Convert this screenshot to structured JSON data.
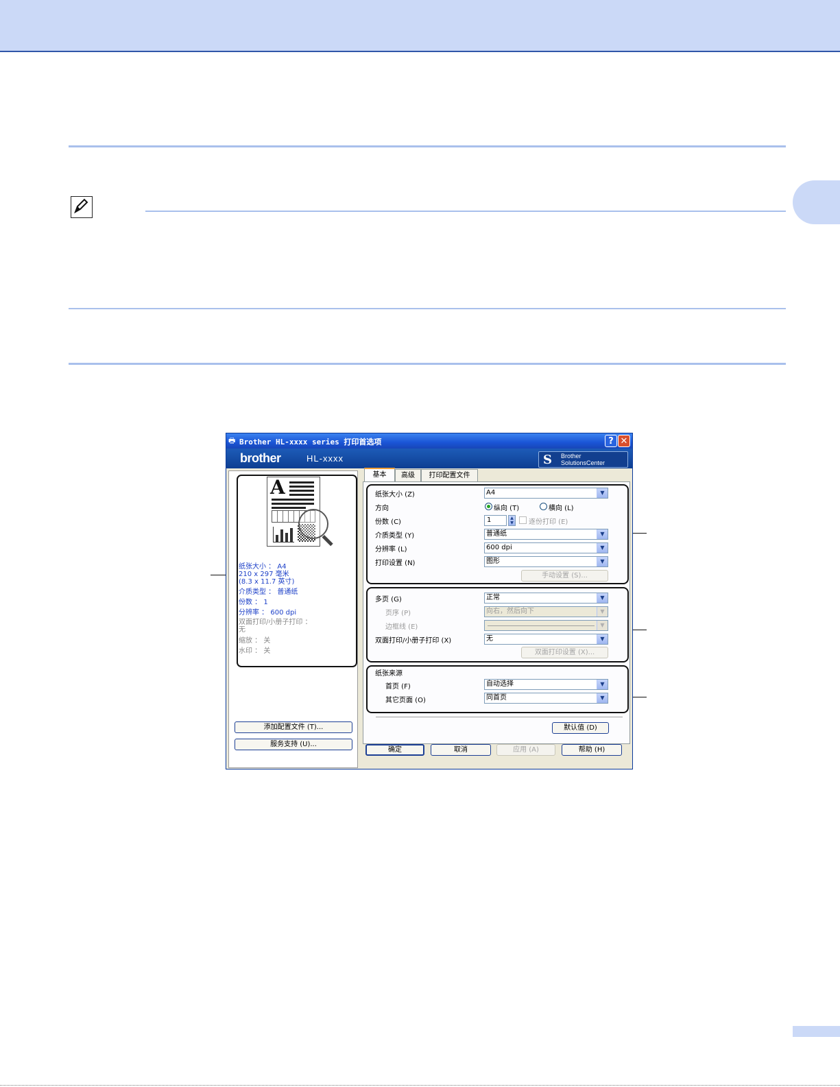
{
  "dialog": {
    "title": "Brother HL-xxxx series 打印首选项",
    "help_glyph": "?",
    "close_glyph": "✕",
    "brand": {
      "logo": "brother",
      "model": "HL-xxxx",
      "solutions_line1": "Brother",
      "solutions_line2": "SolutionsCenter"
    },
    "tabs": [
      "基本",
      "高级",
      "打印配置文件"
    ],
    "summary": {
      "paper_size": "纸张大小 ： A4",
      "dims_mm": "210 x 297 毫米",
      "dims_in": "(8.3 x 11.7 英寸)",
      "media": "介质类型 ： 普通纸",
      "copies": "份数 ： 1",
      "resolution": "分辨率 ： 600 dpi",
      "duplex": "双面打印/小册子打印 ：",
      "duplex_val": "无",
      "scaling": "缩放 ： 关",
      "watermark": "水印 ： 关"
    },
    "left_buttons": {
      "add_profile": "添加配置文件 (T)...",
      "support": "服务支持 (U)..."
    },
    "basic": {
      "paper_size": {
        "label": "纸张大小 (Z)",
        "value": "A4"
      },
      "orientation": {
        "label": "方向",
        "portrait": "纵向 (T)",
        "landscape": "横向 (L)"
      },
      "copies": {
        "label": "份数 (C)",
        "value": "1",
        "collate": "逐份打印 (E)"
      },
      "media_type": {
        "label": "介质类型 (Y)",
        "value": "普通纸"
      },
      "resolution": {
        "label": "分辨率 (L)",
        "value": "600 dpi"
      },
      "print_setting": {
        "label": "打印设置 (N)",
        "value": "图形"
      },
      "manual_settings": "手动设置 (S)...",
      "multiple_page": {
        "label": "多页 (G)",
        "value": "正常"
      },
      "page_order": {
        "label": "页序 (P)",
        "value": "向右，然后向下"
      },
      "border_line": {
        "label": "边框线 (E)",
        "value": ""
      },
      "duplex": {
        "label": "双面打印/小册子打印 (X)",
        "value": "无"
      },
      "duplex_settings": "双面打印设置 (X)...",
      "paper_source": {
        "title": "纸张来源",
        "first_label": "首页 (F)",
        "first_value": "自动选择",
        "other_label": "其它页面 (O)",
        "other_value": "同首页"
      },
      "default": "默认值 (D)"
    },
    "footer": {
      "ok": "确定",
      "cancel": "取消",
      "apply": "应用 (A)",
      "help": "帮助 (H)"
    }
  }
}
